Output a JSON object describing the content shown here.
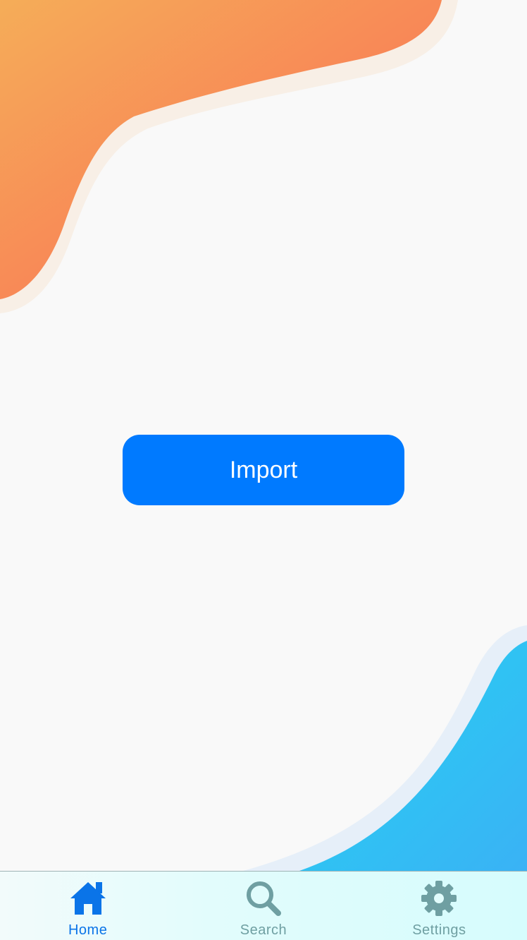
{
  "main": {
    "import_label": "Import"
  },
  "tab_bar": {
    "items": [
      {
        "label": "Home",
        "icon": "home-icon",
        "active": true
      },
      {
        "label": "Search",
        "icon": "search-icon",
        "active": false
      },
      {
        "label": "Settings",
        "icon": "gear-icon",
        "active": false
      }
    ]
  },
  "colors": {
    "accent": "#007aff",
    "active_tab": "#0a74e8",
    "inactive_tab": "#6f9fa2",
    "top_blob": "#f7784f",
    "bottom_blob": "#2ec9f2"
  }
}
